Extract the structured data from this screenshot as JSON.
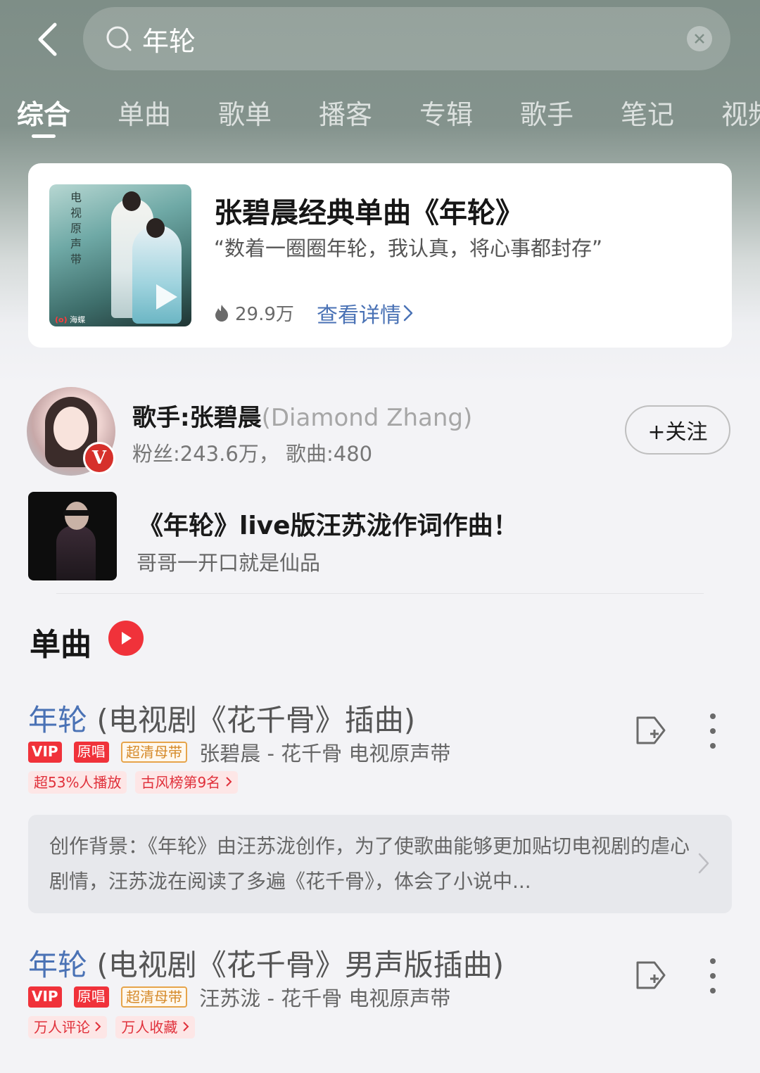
{
  "search": {
    "query": "年轮"
  },
  "tabs": [
    "综合",
    "单曲",
    "歌单",
    "播客",
    "专辑",
    "歌手",
    "笔记",
    "视频"
  ],
  "featured": {
    "cover_text": "电视原声带",
    "cover_logo": "海蝶",
    "title": "张碧晨经典单曲《年轮》",
    "quote": "“数着一圈圈年轮，我认真，将心事都封存”",
    "heat": "29.9万",
    "link": "查看详情"
  },
  "singer": {
    "label": "歌手:张碧晨",
    "english": "(Diamond Zhang)",
    "meta": "粉丝:243.6万， 歌曲:480",
    "badge": "V",
    "follow": "+关注"
  },
  "live": {
    "title": "《年轮》live版汪苏泷作词作曲！",
    "subtitle": "哥哥一开口就是仙品"
  },
  "singles": {
    "section_title": "单曲",
    "tags": {
      "vip": "VIP",
      "orig": "原唱",
      "hq": "超清母带"
    },
    "songs": [
      {
        "name": "年轮",
        "desc": " (电视剧《花千骨》插曲)",
        "artist": "张碧晨 - 花千骨 电视原声带",
        "pills": [
          "超53%人播放",
          "古风榜第9名"
        ]
      },
      {
        "name": "年轮",
        "desc": " (电视剧《花千骨》男声版插曲)",
        "artist": "汪苏泷 - 花千骨 电视原声带",
        "pills": [
          "万人评论",
          "万人收藏"
        ]
      }
    ],
    "background": "创作背景：《年轮》由汪苏泷创作，为了使歌曲能够更加贴切电视剧的虐心剧情，汪苏泷在阅读了多遍《花千骨》，体会了小说中..."
  },
  "colors": {
    "accent": "#4a72b5",
    "red": "#f0323a",
    "header": "#808f89"
  }
}
